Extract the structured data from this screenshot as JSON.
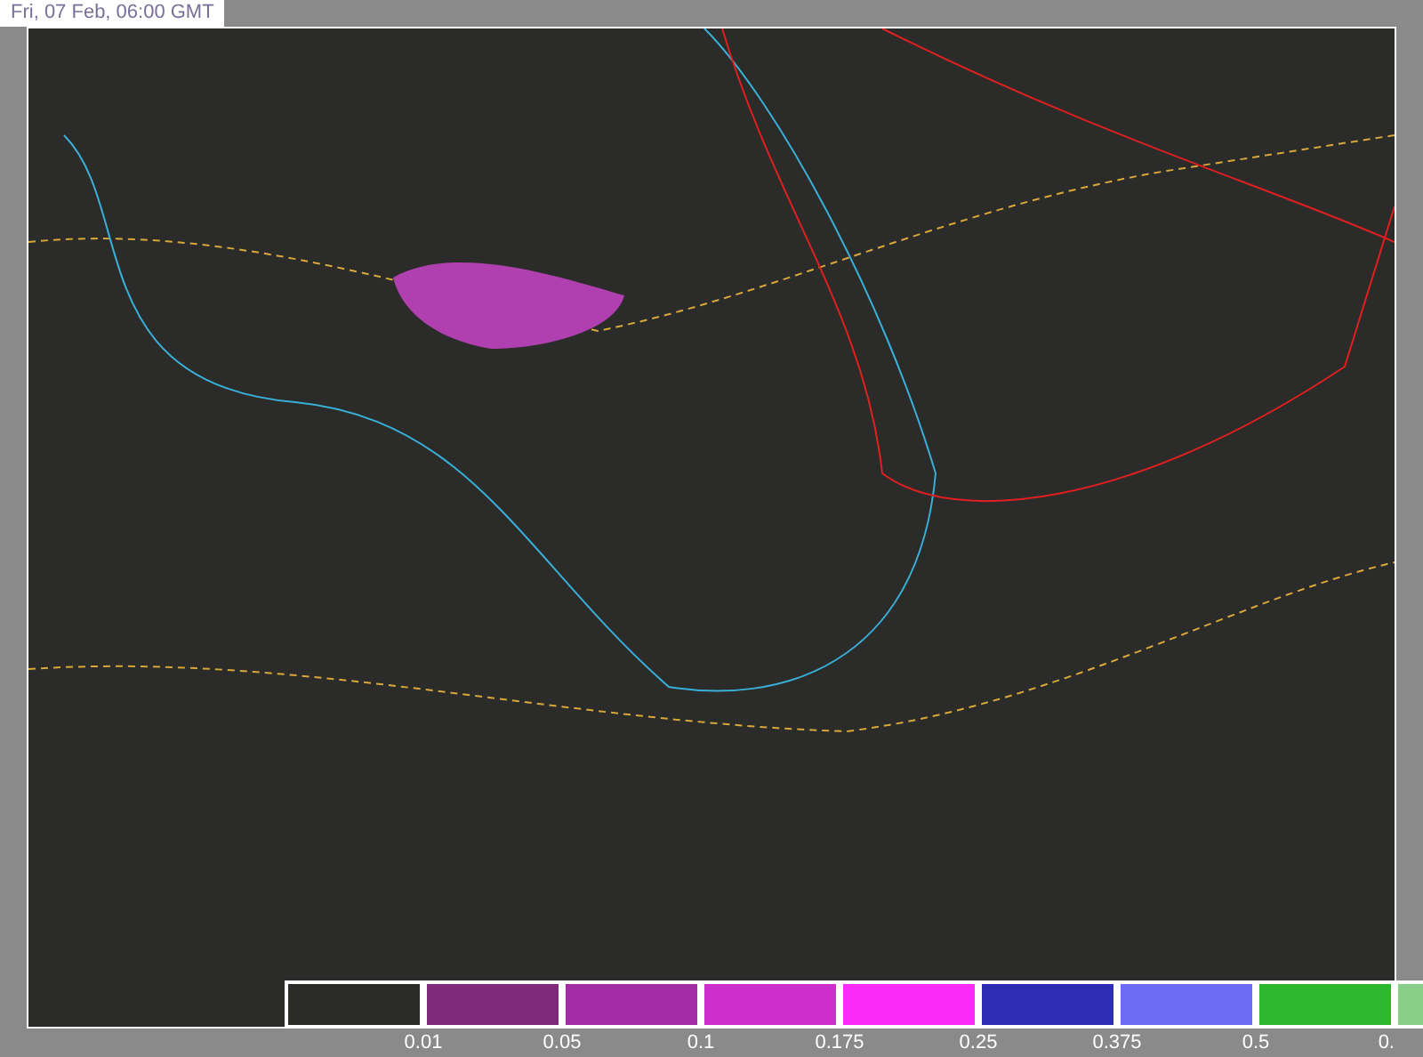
{
  "timestamp": "Fri, 07 Feb, 06:00 GMT",
  "legend": {
    "bins": [
      {
        "color": "#2b2b27",
        "label": "0.01"
      },
      {
        "color": "#7f2a7a",
        "label": "0.05"
      },
      {
        "color": "#a32ba3",
        "label": "0.1"
      },
      {
        "color": "#cc2ecc",
        "label": "0.175"
      },
      {
        "color": "#fa2bfa",
        "label": "0.25"
      },
      {
        "color": "#2e2bb5",
        "label": "0.375"
      },
      {
        "color": "#6b6bf5",
        "label": "0.5"
      },
      {
        "color": "#2cb82c",
        "label": "0."
      },
      {
        "color": "#88d088"
      }
    ]
  }
}
